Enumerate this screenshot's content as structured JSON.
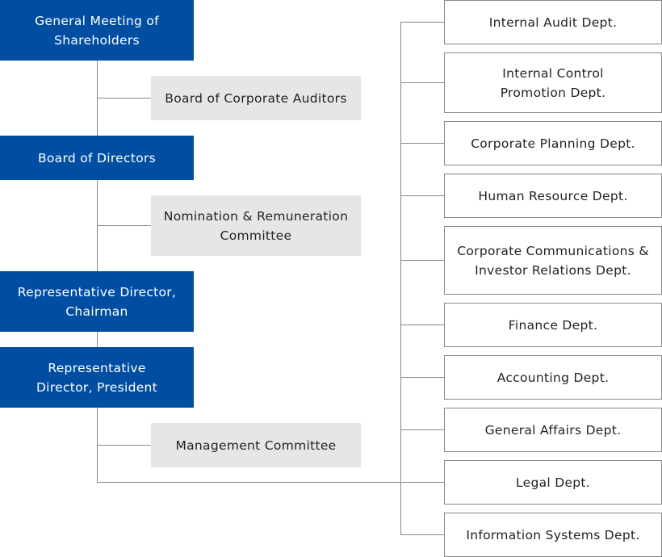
{
  "governance": [
    "General Meeting of\nShareholders",
    "Board of Directors",
    "Representative Director,\nChairman",
    "Representative\nDirector, President"
  ],
  "committees": [
    "Board of Corporate Auditors",
    "Nomination & Remuneration\nCommittee",
    "Management Committee"
  ],
  "departments": [
    "Internal Audit Dept.",
    "Internal Control\nPromotion Dept.",
    "Corporate Planning Dept.",
    "Human Resource Dept.",
    "Corporate Communications &\nInvestor Relations Dept.",
    "Finance Dept.",
    "Accounting Dept.",
    "General Affairs Dept.",
    "Legal Dept.",
    "Information Systems Dept."
  ],
  "colors": {
    "governance": "#004ea2",
    "committee": "#e6e6e6",
    "line": "#888888"
  }
}
